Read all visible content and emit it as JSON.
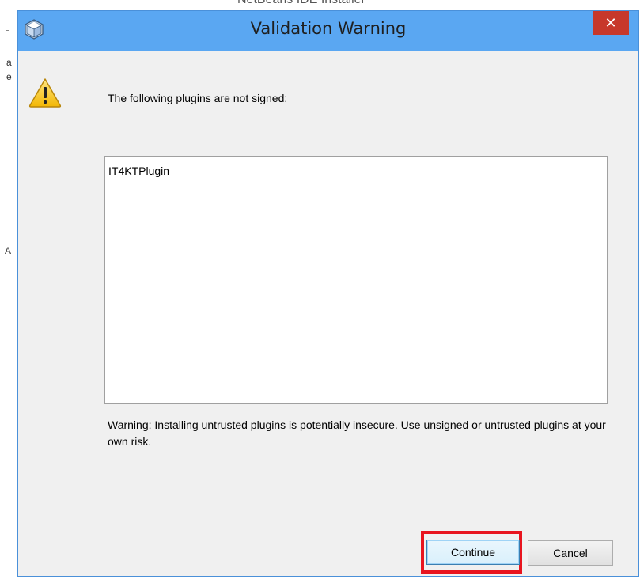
{
  "background": {
    "window_title_fragment": "NetBeans IDE Installer",
    "left_fragments": [
      "a",
      "e",
      "A"
    ]
  },
  "dialog": {
    "title": "Validation Warning",
    "close_glyph": "✕",
    "app_icon": "netbeans-cube-icon",
    "warning_icon": "warning-triangle-icon",
    "message": "The following plugins are not signed:",
    "plugins": [
      "IT4KTPlugin"
    ],
    "disclaimer": "Warning: Installing untrusted plugins is potentially insecure. Use unsigned or untrusted plugins at your own risk.",
    "buttons": {
      "continue_label": "Continue",
      "cancel_label": "Cancel"
    }
  },
  "colors": {
    "titlebar": "#5aa7f2",
    "close_button": "#c7382b",
    "highlight": "#e8141e"
  }
}
